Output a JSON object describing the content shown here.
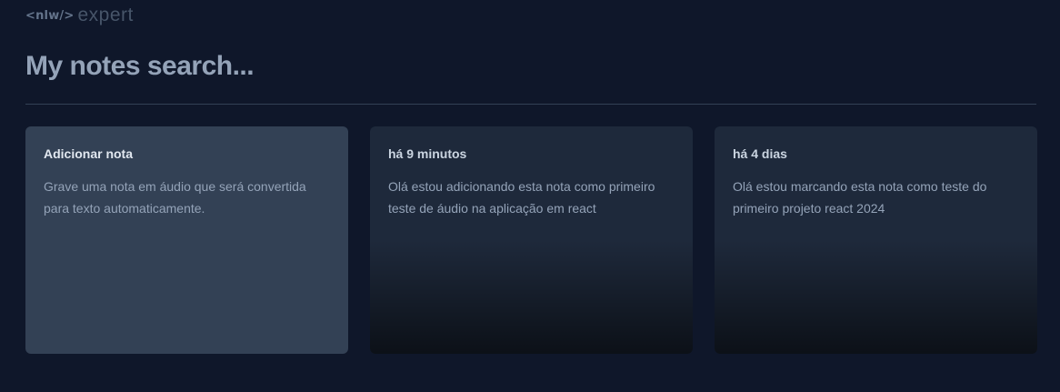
{
  "logo": {
    "code": "<nlw/>",
    "word": "expert"
  },
  "search": {
    "placeholder": "My notes search...",
    "value": ""
  },
  "add_card": {
    "title": "Adicionar nota",
    "description": "Grave uma nota em áudio que será convertida para texto automaticamente."
  },
  "notes": [
    {
      "date": "há 9 minutos",
      "content": "Olá estou adicionando esta nota como primeiro teste de áudio na aplicação em react"
    },
    {
      "date": "há 4 dias",
      "content": "Olá estou marcando esta nota como teste do primeiro projeto react 2024"
    }
  ],
  "colors": {
    "background": "#0f172a",
    "add_card": "#334155",
    "note_card": "#1e293b",
    "divider": "#334155",
    "placeholder": "#94a3b8"
  }
}
